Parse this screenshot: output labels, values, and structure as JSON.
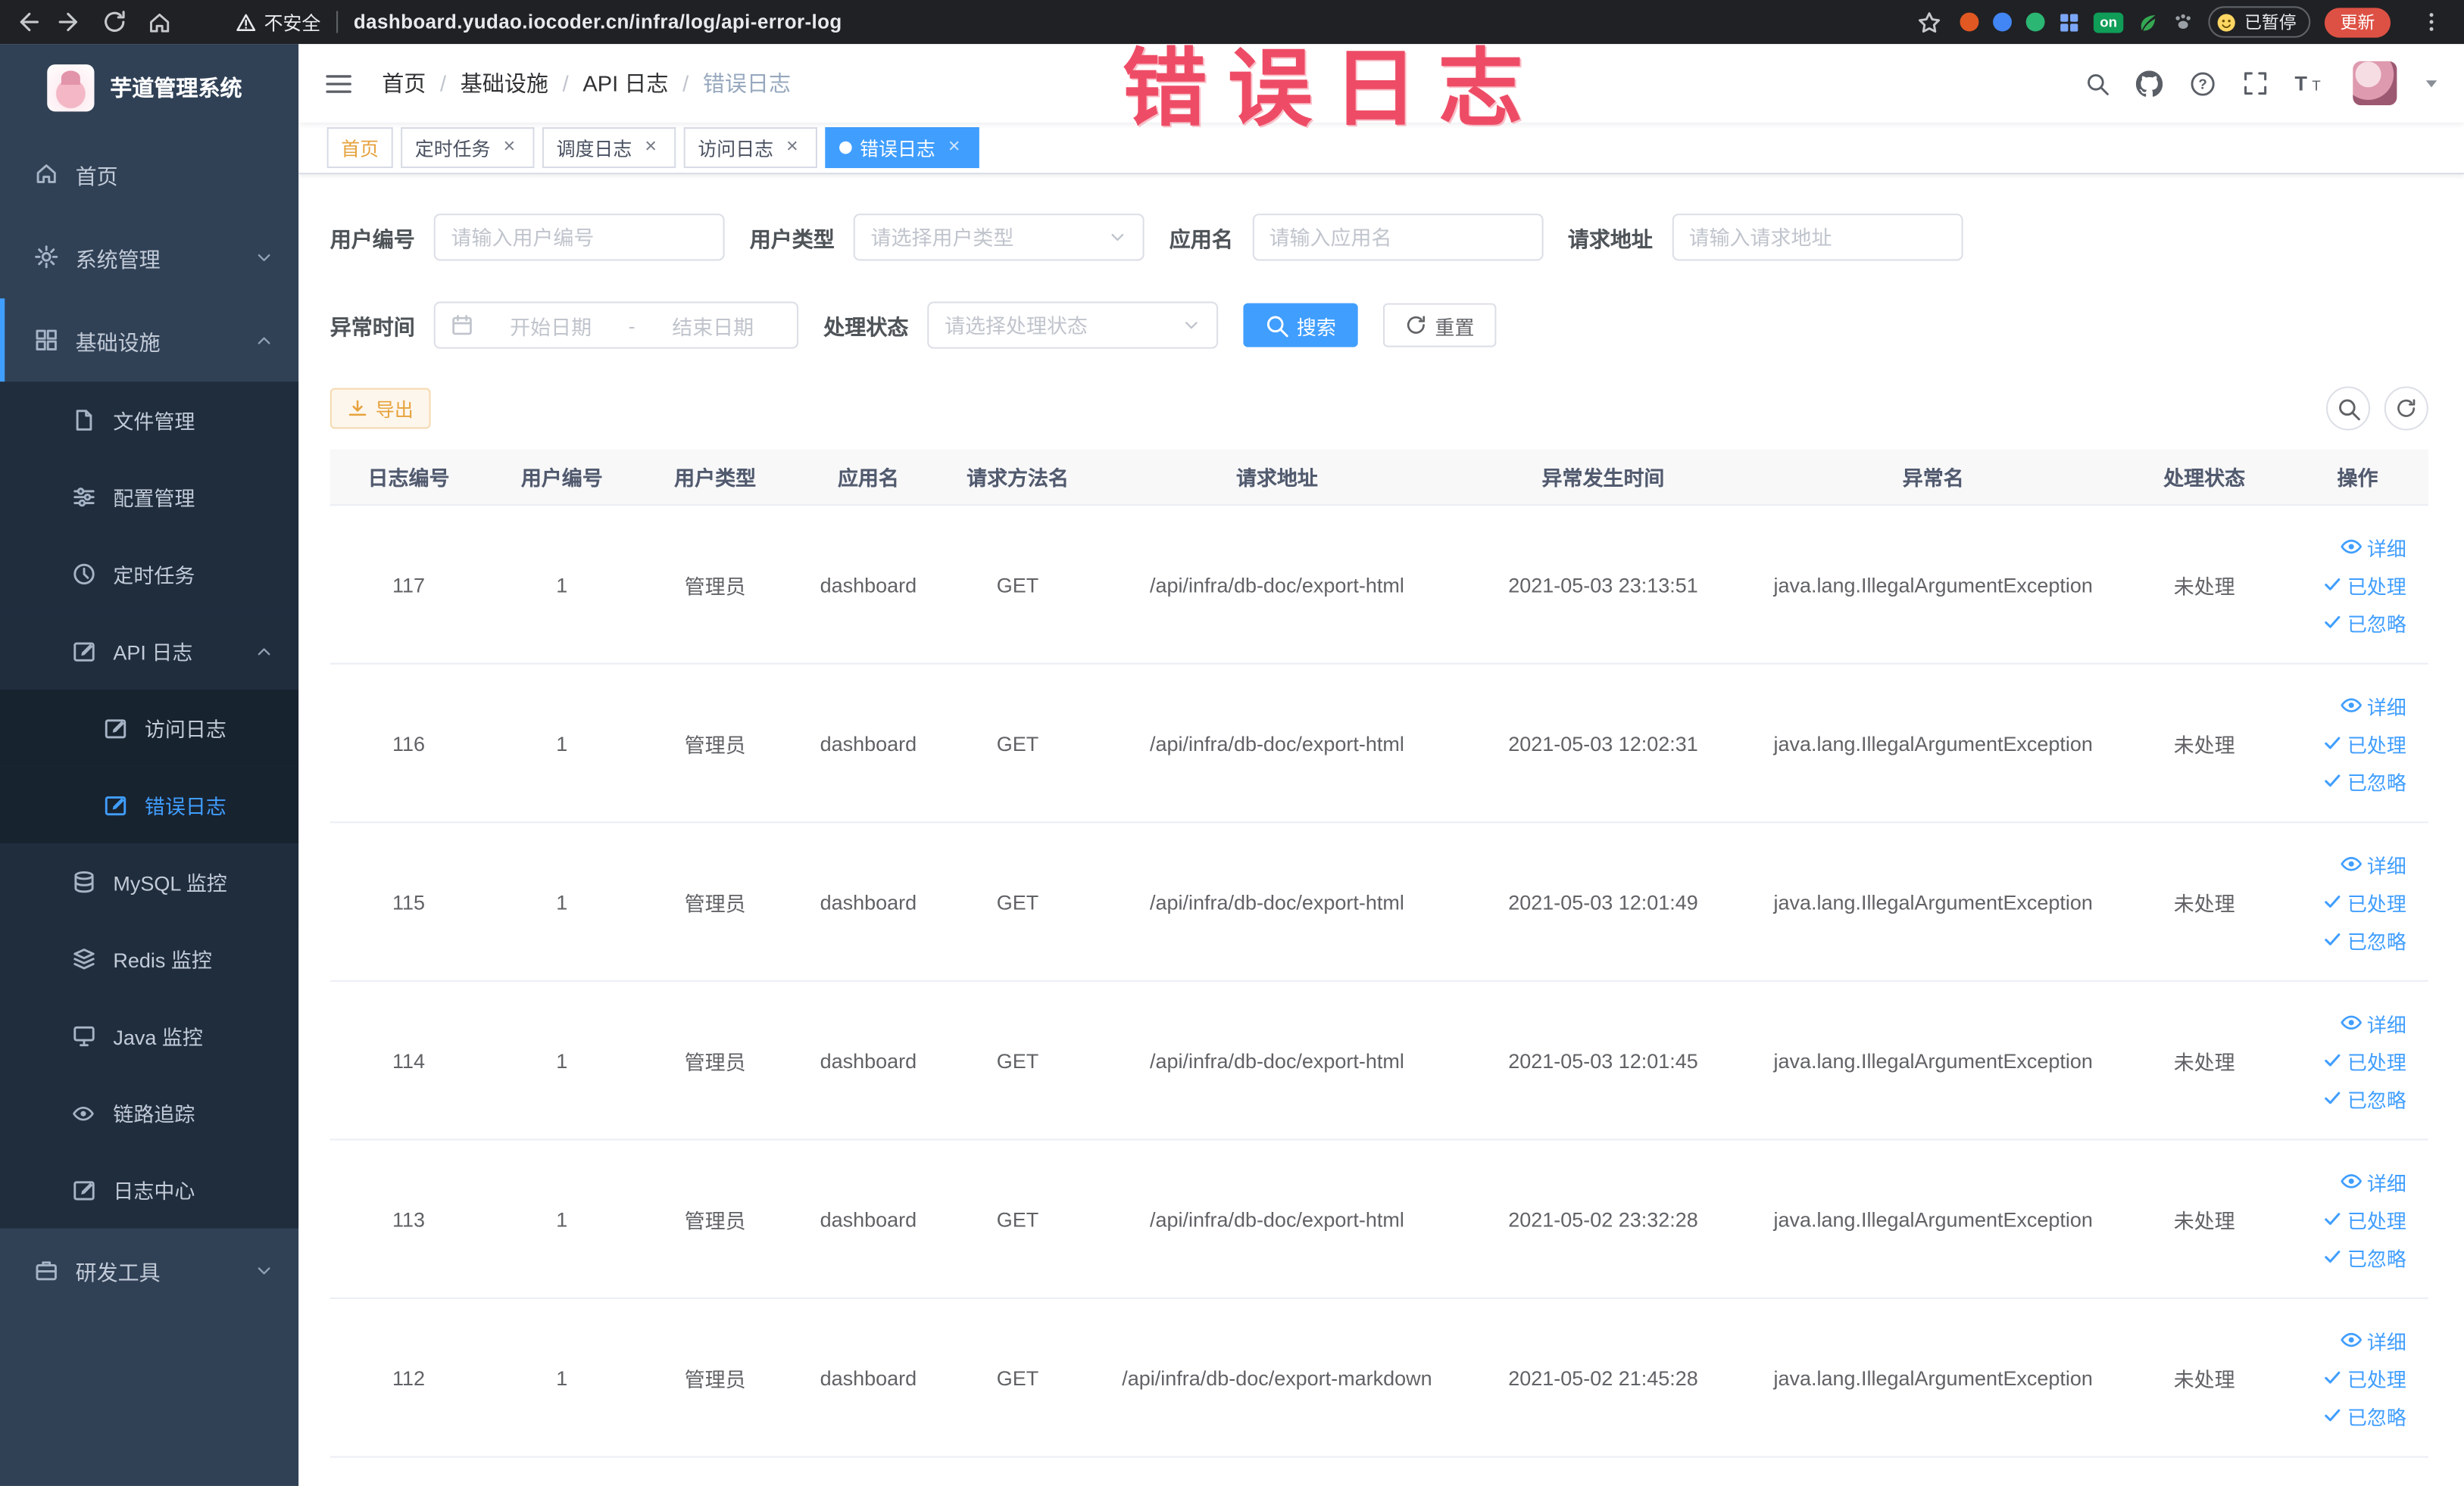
{
  "browser": {
    "security_label": "不安全",
    "url": "dashboard.yudao.iocoder.cn/infra/log/api-error-log",
    "paused_badge": "已暂停",
    "update_button": "更新",
    "on_badge": "on"
  },
  "watermark": "错误日志",
  "glyphs": {
    "tab_close": "×",
    "breadcrumb_separator": "/"
  },
  "colors": {
    "accent": "#409EFF",
    "active_tab_bg": "#409EFF",
    "warning": "#e6a23c",
    "watermark": "#ee4c66",
    "sidebar_bg": "#304156",
    "submenu_bg": "#1f2d3d"
  },
  "sidebar": {
    "title": "芋道管理系统",
    "items": [
      {
        "label": "首页",
        "icon": "home-icon",
        "level": 1
      },
      {
        "label": "系统管理",
        "icon": "gear-icon",
        "level": 1,
        "chevron": "down"
      },
      {
        "label": "基础设施",
        "icon": "grid-icon",
        "level": 1,
        "chevron": "up",
        "open": true
      },
      {
        "label": "文件管理",
        "icon": "file-icon",
        "level": 2
      },
      {
        "label": "配置管理",
        "icon": "sliders-icon",
        "level": 2
      },
      {
        "label": "定时任务",
        "icon": "clock-icon",
        "level": 2
      },
      {
        "label": "API 日志",
        "icon": "edit-square-icon",
        "level": 2,
        "chevron": "up",
        "open": true
      },
      {
        "label": "访问日志",
        "icon": "edit-square-icon",
        "level": 3
      },
      {
        "label": "错误日志",
        "icon": "edit-square-icon",
        "level": 3,
        "active": true
      },
      {
        "label": "MySQL 监控",
        "icon": "database-icon",
        "level": 2
      },
      {
        "label": "Redis 监控",
        "icon": "layers-icon",
        "level": 2
      },
      {
        "label": "Java 监控",
        "icon": "monitor-icon",
        "level": 2
      },
      {
        "label": "链路追踪",
        "icon": "eye-icon",
        "level": 2
      },
      {
        "label": "日志中心",
        "icon": "edit-square-icon",
        "level": 2
      },
      {
        "label": "研发工具",
        "icon": "briefcase-icon",
        "level": 1,
        "chevron": "down"
      }
    ]
  },
  "header": {
    "breadcrumb": [
      "首页",
      "基础设施",
      "API 日志",
      "错误日志"
    ],
    "action_icons": [
      "search-icon",
      "github-icon",
      "question-icon",
      "fullscreen-icon",
      "fontsize-icon",
      "avatar",
      "caret-down-icon"
    ]
  },
  "tabs": [
    {
      "label": "首页",
      "closable": false,
      "active": false,
      "affix": true
    },
    {
      "label": "定时任务",
      "closable": true,
      "active": false
    },
    {
      "label": "调度日志",
      "closable": true,
      "active": false
    },
    {
      "label": "访问日志",
      "closable": true,
      "active": false
    },
    {
      "label": "错误日志",
      "closable": true,
      "active": true
    }
  ],
  "filters": {
    "user_id": {
      "label": "用户编号",
      "placeholder": "请输入用户编号"
    },
    "user_type": {
      "label": "用户类型",
      "placeholder": "请选择用户类型"
    },
    "app_name": {
      "label": "应用名",
      "placeholder": "请输入应用名"
    },
    "request_url": {
      "label": "请求地址",
      "placeholder": "请输入请求地址"
    },
    "exception_time": {
      "label": "异常时间",
      "start_placeholder": "开始日期",
      "separator": "-",
      "end_placeholder": "结束日期"
    },
    "process_status": {
      "label": "处理状态",
      "placeholder": "请选择处理状态"
    },
    "search_button": "搜索",
    "reset_button": "重置"
  },
  "toolbar": {
    "export_button": "导出"
  },
  "table": {
    "columns": [
      "日志编号",
      "用户编号",
      "用户类型",
      "应用名",
      "请求方法名",
      "请求地址",
      "异常发生时间",
      "异常名",
      "处理状态",
      "操作"
    ],
    "actions": [
      "详细",
      "已处理",
      "已忽略"
    ],
    "rows": [
      {
        "log_id": "117",
        "user_id": "1",
        "user_type": "管理员",
        "app_name": "dashboard",
        "method": "GET",
        "url": "/api/infra/db-doc/export-html",
        "time": "2021-05-03 23:13:51",
        "exception": "java.lang.IllegalArgumentException",
        "status": "未处理"
      },
      {
        "log_id": "116",
        "user_id": "1",
        "user_type": "管理员",
        "app_name": "dashboard",
        "method": "GET",
        "url": "/api/infra/db-doc/export-html",
        "time": "2021-05-03 12:02:31",
        "exception": "java.lang.IllegalArgumentException",
        "status": "未处理"
      },
      {
        "log_id": "115",
        "user_id": "1",
        "user_type": "管理员",
        "app_name": "dashboard",
        "method": "GET",
        "url": "/api/infra/db-doc/export-html",
        "time": "2021-05-03 12:01:49",
        "exception": "java.lang.IllegalArgumentException",
        "status": "未处理"
      },
      {
        "log_id": "114",
        "user_id": "1",
        "user_type": "管理员",
        "app_name": "dashboard",
        "method": "GET",
        "url": "/api/infra/db-doc/export-html",
        "time": "2021-05-03 12:01:45",
        "exception": "java.lang.IllegalArgumentException",
        "status": "未处理"
      },
      {
        "log_id": "113",
        "user_id": "1",
        "user_type": "管理员",
        "app_name": "dashboard",
        "method": "GET",
        "url": "/api/infra/db-doc/export-html",
        "time": "2021-05-02 23:32:28",
        "exception": "java.lang.IllegalArgumentException",
        "status": "未处理"
      },
      {
        "log_id": "112",
        "user_id": "1",
        "user_type": "管理员",
        "app_name": "dashboard",
        "method": "GET",
        "url": "/api/infra/db-doc/export-markdown",
        "time": "2021-05-02 21:45:28",
        "exception": "java.lang.IllegalArgumentException",
        "status": "未处理"
      }
    ]
  }
}
